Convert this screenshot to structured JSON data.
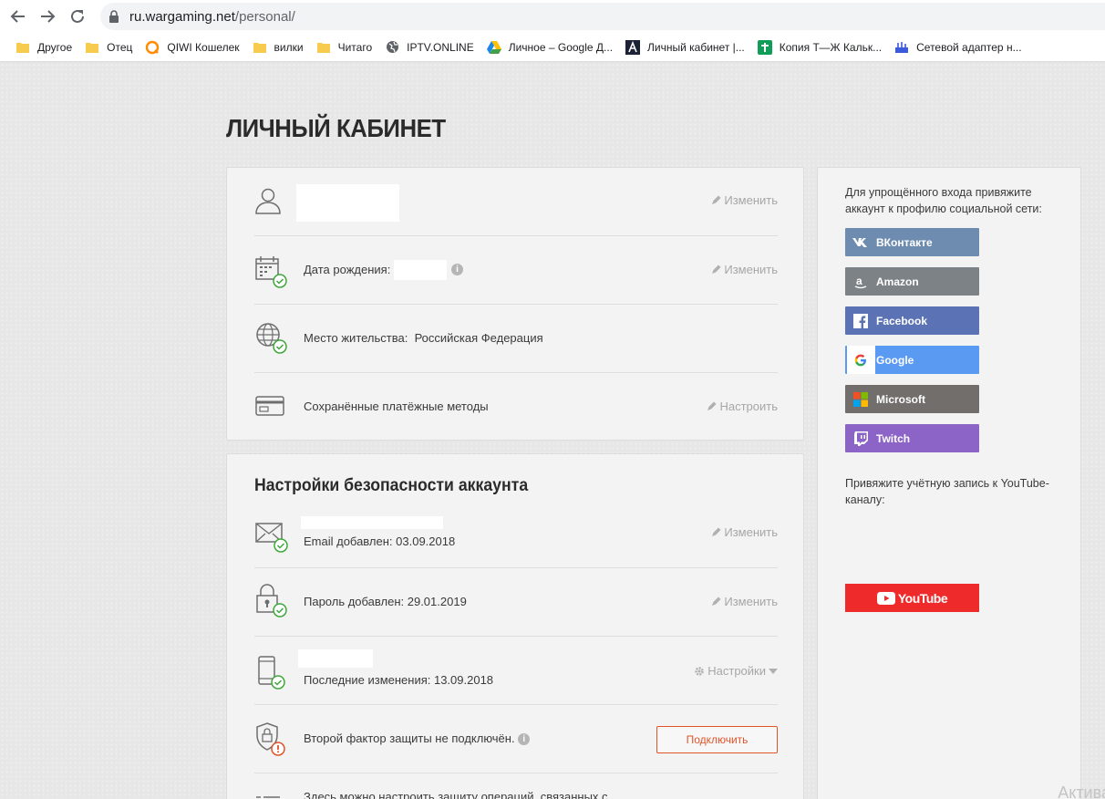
{
  "browser": {
    "url_host": "ru.wargaming.net",
    "url_path": "/personal/",
    "bookmarks": [
      {
        "label": "Другое",
        "icon": "folder-icon"
      },
      {
        "label": "Отец",
        "icon": "folder-icon"
      },
      {
        "label": "QIWI Кошелек",
        "icon": "qiwi-icon"
      },
      {
        "label": "вилки",
        "icon": "folder-icon"
      },
      {
        "label": "Читаго",
        "icon": "folder-icon"
      },
      {
        "label": "IPTV.ONLINE",
        "icon": "globe-icon"
      },
      {
        "label": "Личное – Google Д...",
        "icon": "google-drive-icon"
      },
      {
        "label": "Личный кабинет |...",
        "icon": "a-logo-icon"
      },
      {
        "label": "Копия Т—Ж Кальк...",
        "icon": "sheets-icon"
      },
      {
        "label": "Сетевой адаптер н...",
        "icon": "network-adapter-icon"
      }
    ]
  },
  "page": {
    "title": "ЛИЧНЫЙ КАБИНЕТ"
  },
  "profile": {
    "edit_label": "Изменить",
    "birthdate_label": "Дата рождения:",
    "residence_label": "Место жительства:",
    "residence_value": "Российская Федерация",
    "payment_label": "Сохранённые платёжные методы",
    "configure_label": "Настроить"
  },
  "security": {
    "title": "Настройки безопасности аккаунта",
    "email_text": "Email добавлен: 03.09.2018",
    "password_text": "Пароль добавлен: 29.01.2019",
    "phone_text": "Последние изменения: 13.09.2018",
    "settings_label": "Настройки",
    "twofactor_text": "Второй фактор защиты не подключён.",
    "connect_label": "Подключить",
    "bottom_text": "Здесь можно настроить защиту операций, связанных с"
  },
  "social": {
    "intro": "Для упрощённого входа привяжите аккаунт к профилю социальной сети:",
    "buttons": [
      {
        "label": "ВКонтакте",
        "color": "#6d8cb0",
        "icon": "vk-icon"
      },
      {
        "label": "Amazon",
        "color": "#7d8286",
        "icon": "amazon-icon"
      },
      {
        "label": "Facebook",
        "color": "#5b72b5",
        "icon": "facebook-icon"
      },
      {
        "label": "Google",
        "color": "#5b9af3",
        "icon": "google-icon"
      },
      {
        "label": "Microsoft",
        "color": "#716e6c",
        "icon": "microsoft-icon"
      },
      {
        "label": "Twitch",
        "color": "#8c63c7",
        "icon": "twitch-icon"
      }
    ],
    "youtube_intro": "Привяжите учётную запись к YouTube-каналу:",
    "youtube_label": "YouTube"
  },
  "os": {
    "watermark": "Актива"
  }
}
